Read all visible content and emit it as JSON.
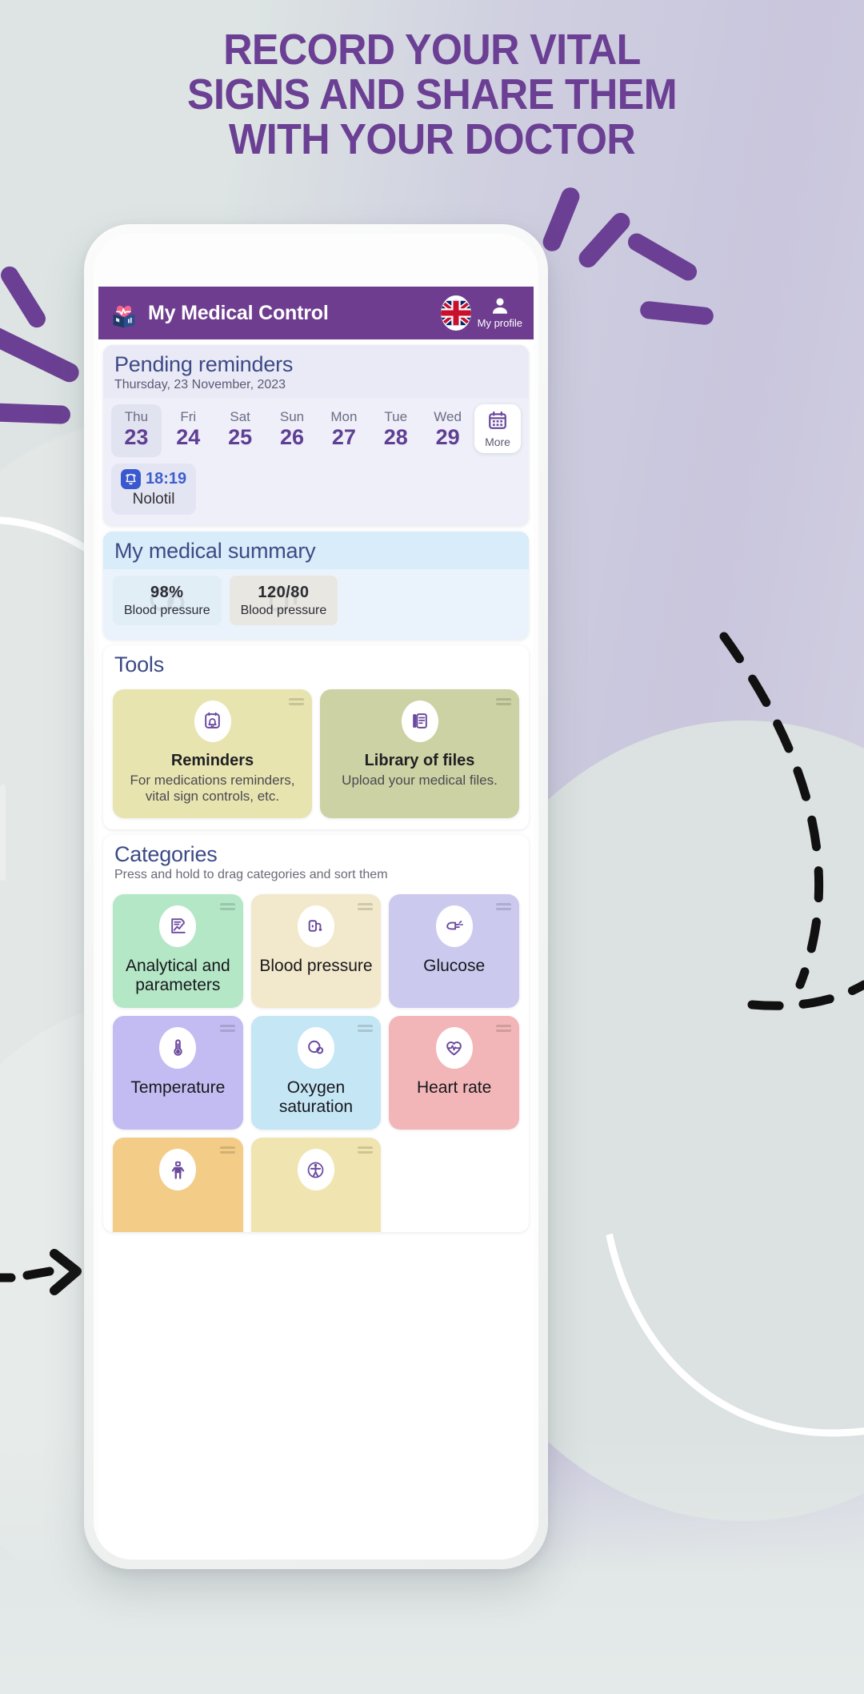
{
  "promo": {
    "headline_lines": [
      "RECORD YOUR VITAL",
      "SIGNS AND SHARE THEM",
      "WITH YOUR DOCTOR"
    ],
    "headline_color": "#6b3f93",
    "background_color": "#dfe5e4"
  },
  "app": {
    "header": {
      "title": "My Medical Control",
      "logo_icon": "heart-book-logo-icon",
      "language_flag": "uk-flag-icon",
      "profile_icon": "person-icon",
      "profile_label": "My profile",
      "bar_color": "#6e3d8f"
    },
    "reminders": {
      "title": "Pending reminders",
      "date": "Thursday, 23 November, 2023",
      "days": [
        {
          "name": "Thu",
          "num": "23",
          "active": true
        },
        {
          "name": "Fri",
          "num": "24",
          "active": false
        },
        {
          "name": "Sat",
          "num": "25",
          "active": false
        },
        {
          "name": "Sun",
          "num": "26",
          "active": false
        },
        {
          "name": "Mon",
          "num": "27",
          "active": false
        },
        {
          "name": "Tue",
          "num": "28",
          "active": false
        },
        {
          "name": "Wed",
          "num": "29",
          "active": false
        }
      ],
      "more_label": "More",
      "more_icon": "calendar-icon",
      "items": [
        {
          "time": "18:19",
          "name": "Nolotil",
          "icon": "alarm-icon"
        }
      ]
    },
    "summary": {
      "title": "My medical summary",
      "chips": [
        {
          "value": "98%",
          "label": "Blood pressure",
          "bg": "#e1eef6",
          "watermark_icon": "oxygen-icon"
        },
        {
          "value": "120/80",
          "label": "Blood pressure",
          "bg": "#e8e7e2",
          "watermark_icon": "blood-pressure-icon"
        }
      ]
    },
    "tools": {
      "title": "Tools",
      "items": [
        {
          "label": "Reminders",
          "desc": "For medications reminders, vital sign controls, etc.",
          "bg": "#e8e4b0",
          "icon": "reminder-bell-calendar-icon"
        },
        {
          "label": "Library of files",
          "desc": "Upload your medical files.",
          "bg": "#ccd2a3",
          "icon": "files-library-icon"
        }
      ]
    },
    "categories": {
      "title": "Categories",
      "subtitle": "Press and hold to drag categories and sort them",
      "items": [
        {
          "label": "Analytical and parameters",
          "bg": "#b4e7c6",
          "icon": "analytics-chart-icon"
        },
        {
          "label": "Blood pressure",
          "bg": "#f2e8cb",
          "icon": "blood-pressure-cuff-icon"
        },
        {
          "label": "Glucose",
          "bg": "#ccc9ef",
          "icon": "glucose-drop-icon"
        },
        {
          "label": "Temperature",
          "bg": "#c3bcf2",
          "icon": "thermometer-icon"
        },
        {
          "label": "Oxygen saturation",
          "bg": "#c5e6f5",
          "icon": "oxygen-saturation-icon"
        },
        {
          "label": "Heart rate",
          "bg": "#f2b6b8",
          "icon": "heart-pulse-icon"
        },
        {
          "label": "",
          "bg": "#f3cd87",
          "icon": "weight-person-icon"
        },
        {
          "label": "",
          "bg": "#f0e5b0",
          "icon": "height-person-icon"
        }
      ]
    }
  }
}
